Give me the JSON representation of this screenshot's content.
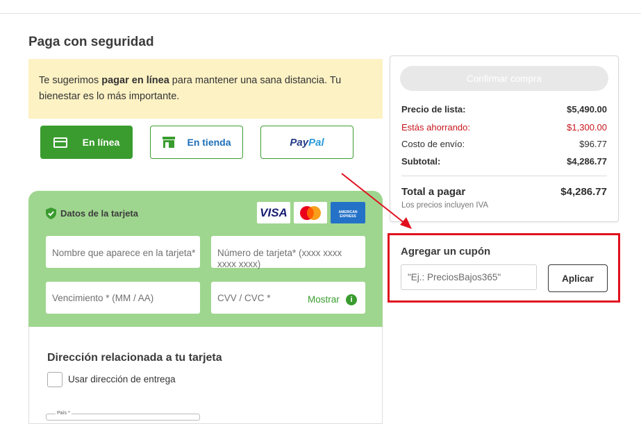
{
  "page": {
    "title": "Paga con seguridad"
  },
  "notice": {
    "prefix": "Te sugerimos ",
    "emphasis": "pagar en línea",
    "suffix": " para mantener una sana distancia. Tu bienestar es lo más importante."
  },
  "payment_methods": {
    "online": "En línea",
    "store": "En tienda",
    "paypal_part1": "Pay",
    "paypal_part2": "Pal"
  },
  "card": {
    "title": "Datos de la tarjeta",
    "brands": {
      "visa": "VISA",
      "amex": "AMERICAN EXPRESS"
    },
    "name_placeholder": "Nombre que aparece en la tarjeta*",
    "number_placeholder": "Número de tarjeta* (xxxx xxxx xxxx xxxx)",
    "expiry_placeholder": "Vencimiento * (MM / AA)",
    "cvv_placeholder": "CVV / CVC *",
    "show_label": "Mostrar",
    "info_glyph": "i"
  },
  "address": {
    "title": "Dirección relacionada a tu tarjeta",
    "use_delivery_label": "Usar dirección de entrega",
    "country_label": "País *"
  },
  "summary": {
    "confirm_label": "Confirmar compra",
    "list_price_label": "Precio de lista:",
    "list_price_value": "$5,490.00",
    "savings_label": "Estás ahorrando:",
    "savings_value": "$1,300.00",
    "shipping_label": "Costo de envío:",
    "shipping_value": "$96.77",
    "subtotal_label": "Subtotal:",
    "subtotal_value": "$4,286.77",
    "total_label": "Total a pagar",
    "total_value": "$4,286.77",
    "iva_note": "Los precios incluyen IVA"
  },
  "coupon": {
    "title": "Agregar un cupón",
    "placeholder": "\"Ej.: PreciosBajos365\"",
    "apply_label": "Aplicar"
  },
  "colors": {
    "primary_green": "#3a9c2f",
    "card_panel_green": "#9fd68f",
    "notice_yellow": "#fdf2c4",
    "savings_red": "#c7161d",
    "highlight_red": "#e0101e",
    "link_blue": "#1c6eb8"
  }
}
